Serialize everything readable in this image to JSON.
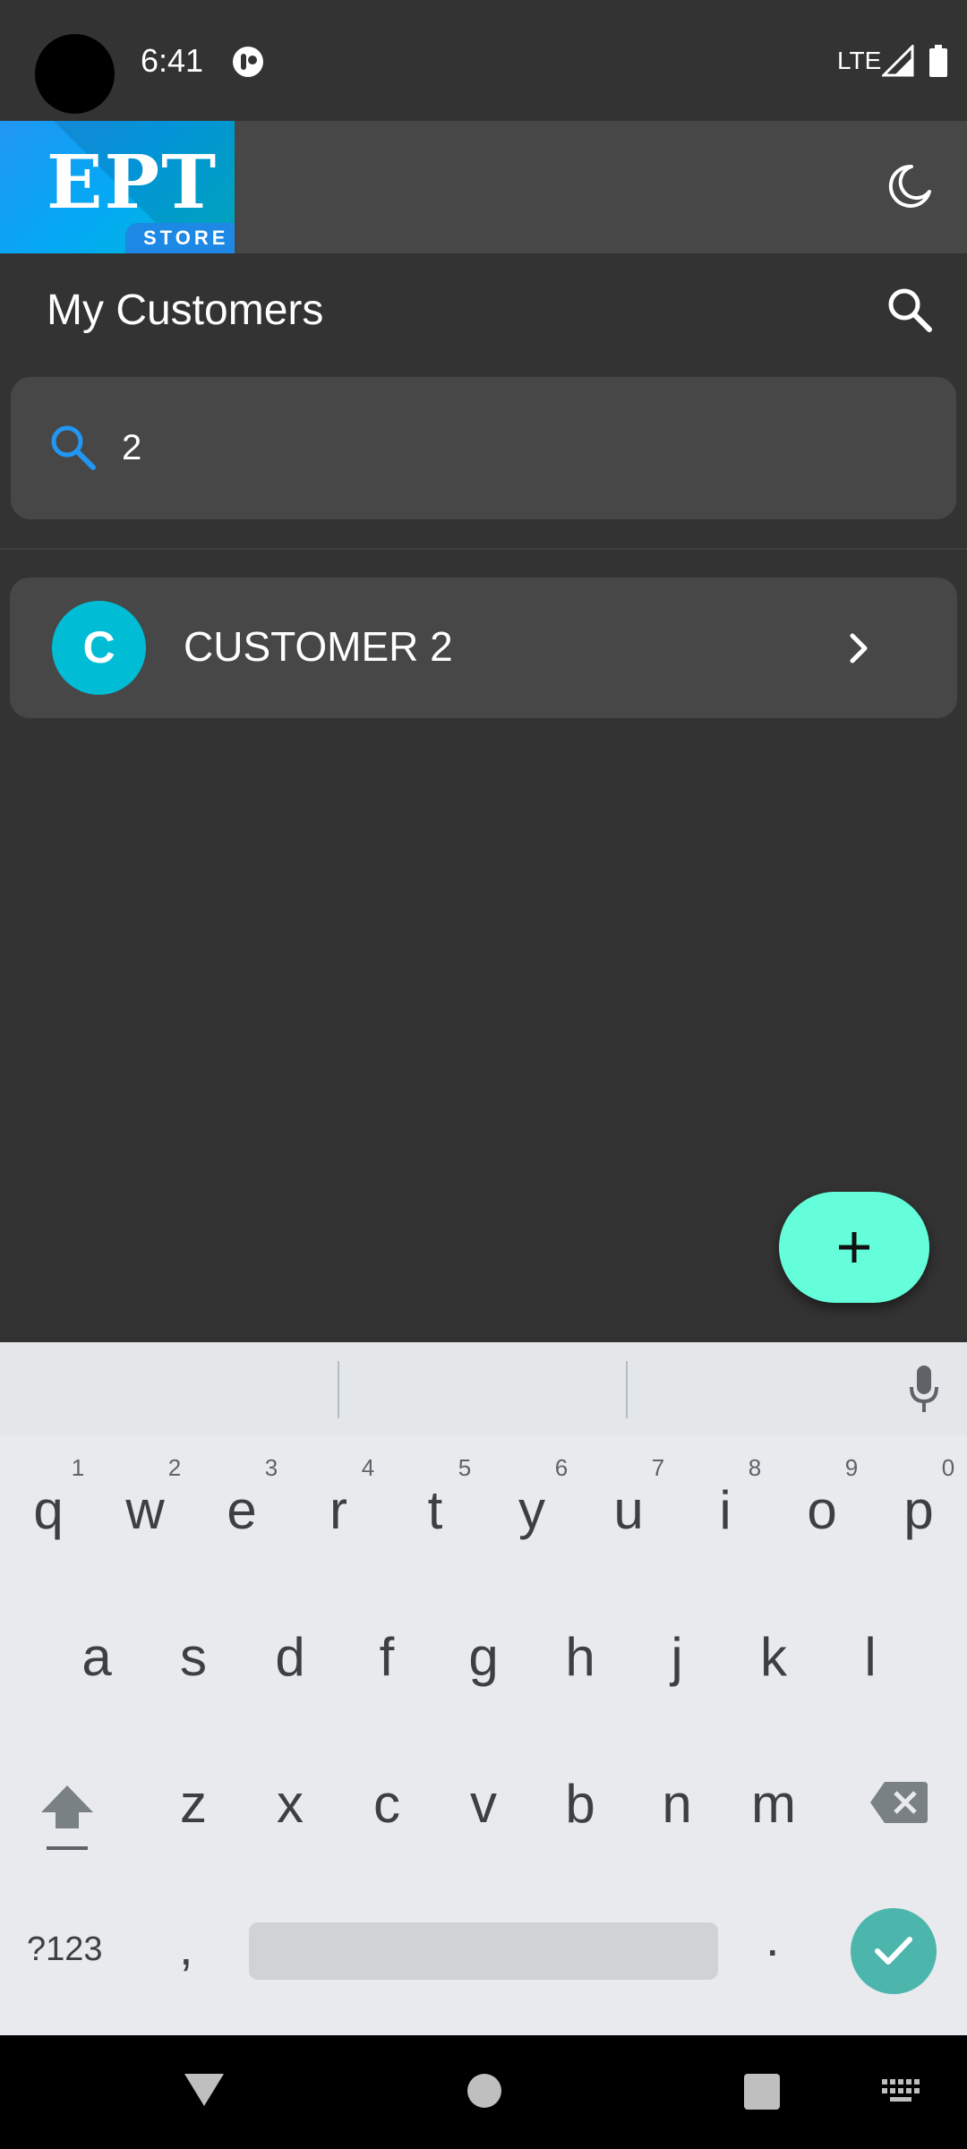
{
  "status_bar": {
    "time": "6:41",
    "network": "LTE"
  },
  "app_bar": {
    "logo_main": "EPT",
    "logo_sub": "STORE",
    "theme_toggle_icon": "moon-icon"
  },
  "page": {
    "title": "My Customers",
    "search_icon": "search-icon"
  },
  "search": {
    "value": "2",
    "placeholder": ""
  },
  "customers": [
    {
      "initial": "C",
      "name": "CUSTOMER 2"
    }
  ],
  "fab": {
    "icon": "plus-icon"
  },
  "keyboard": {
    "row1": [
      "q",
      "w",
      "e",
      "r",
      "t",
      "y",
      "u",
      "i",
      "o",
      "p"
    ],
    "row1_hints": [
      "1",
      "2",
      "3",
      "4",
      "5",
      "6",
      "7",
      "8",
      "9",
      "0"
    ],
    "row2": [
      "a",
      "s",
      "d",
      "f",
      "g",
      "h",
      "j",
      "k",
      "l"
    ],
    "row3": [
      "z",
      "x",
      "c",
      "v",
      "b",
      "n",
      "m"
    ],
    "symbols_label": "?123",
    "comma": ",",
    "period": "."
  },
  "colors": {
    "background": "#333333",
    "surface": "#474747",
    "accent_fab": "#64ffda",
    "avatar": "#00bcd4",
    "search_icon": "#2196f3",
    "keyboard_enter": "#4db6ac"
  }
}
